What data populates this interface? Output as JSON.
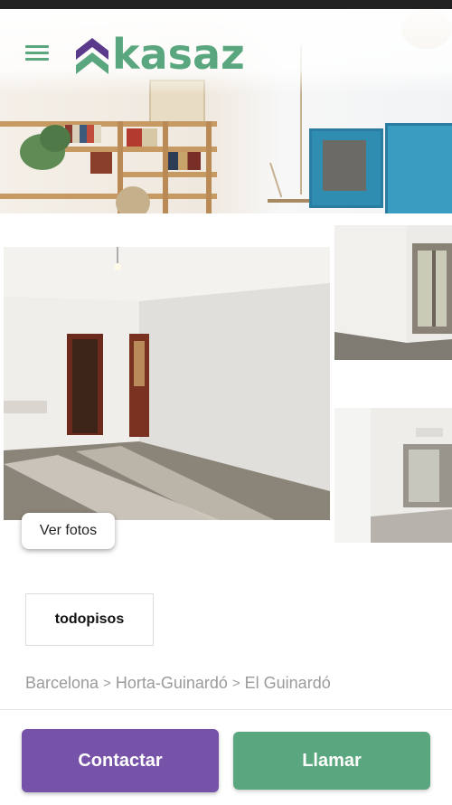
{
  "header": {
    "logo_text": "kasaz",
    "menu_icon": "hamburger-icon"
  },
  "gallery": {
    "ver_fotos_label": "Ver fotos"
  },
  "agency": {
    "name": "todopisos"
  },
  "breadcrumb": {
    "items": [
      "Barcelona",
      "Horta-Guinardó",
      "El Guinardó"
    ],
    "separator": ">"
  },
  "actions": {
    "contactar_label": "Contactar",
    "llamar_label": "Llamar"
  },
  "colors": {
    "brand_green": "#5aa67e",
    "brand_purple": "#7653a8",
    "logo_purple": "#5b3a8c"
  }
}
